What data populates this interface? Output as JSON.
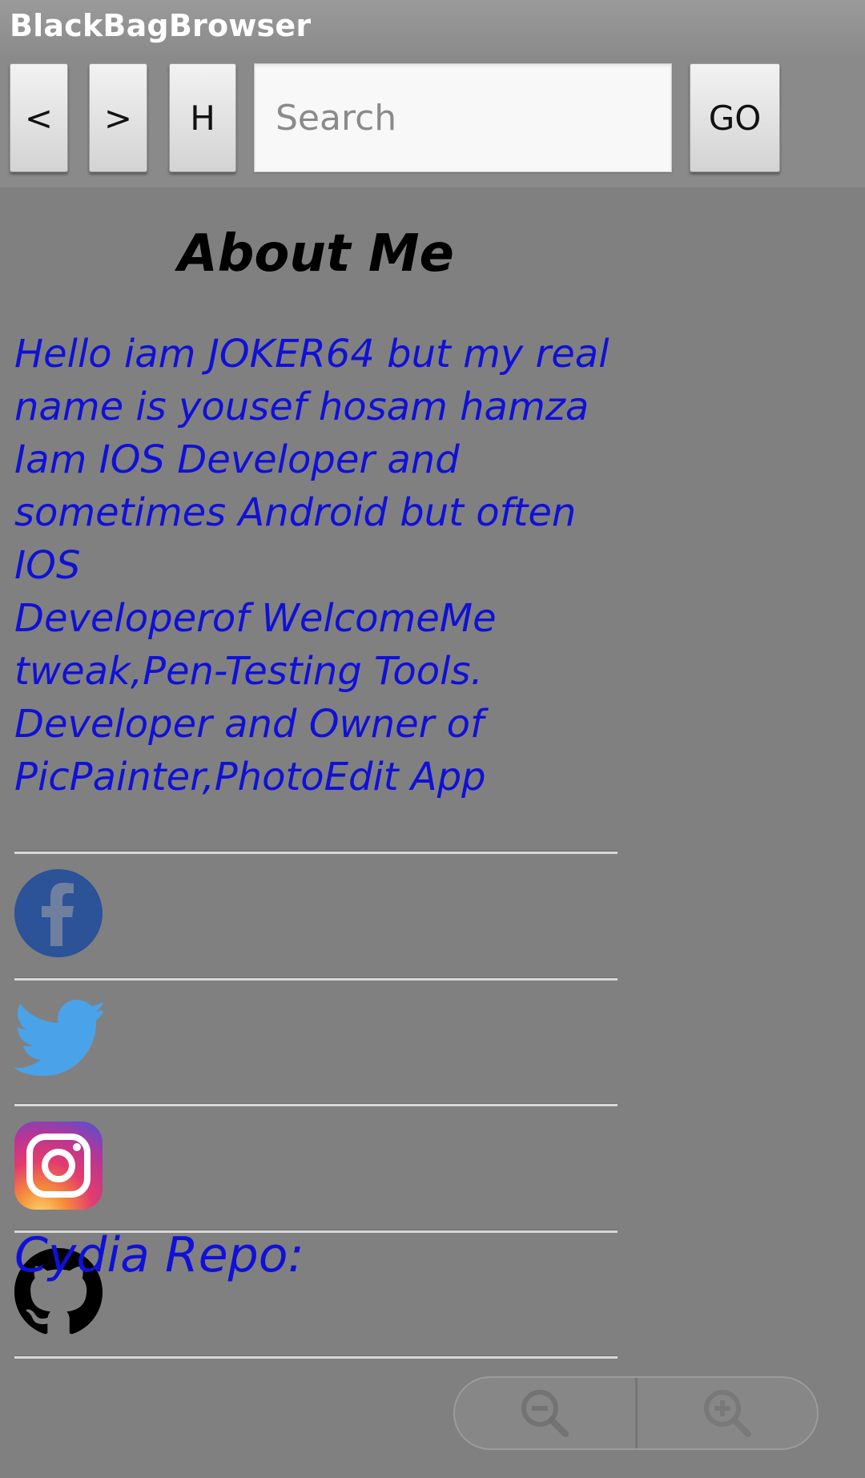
{
  "app": {
    "title": "BlackBagBrowser"
  },
  "toolbar": {
    "back_label": "<",
    "forward_label": ">",
    "home_label": "H",
    "search_placeholder": "Search",
    "search_value": "",
    "go_label": "GO"
  },
  "page": {
    "heading": "About Me",
    "about_lines": [
      "Hello iam JOKER64 but my real name is yousef hosam hamza",
      "Iam IOS Developer and sometimes Android but often IOS",
      "Developerof WelcomeMe tweak,Pen-Testing Tools.",
      "Developer and Owner of PicPainter,PhotoEdit App"
    ],
    "social_icons": [
      "facebook-icon",
      "twitter-icon",
      "instagram-icon",
      "github-icon"
    ],
    "cydia_label": "Cydia Repo:"
  },
  "colors": {
    "background": "#808080",
    "link_text": "#1010d8",
    "facebook": "#2c5298",
    "twitter": "#4aa3e8"
  },
  "zoom_controls": {
    "zoom_out_icon": "zoom-out-icon",
    "zoom_in_icon": "zoom-in-icon"
  }
}
